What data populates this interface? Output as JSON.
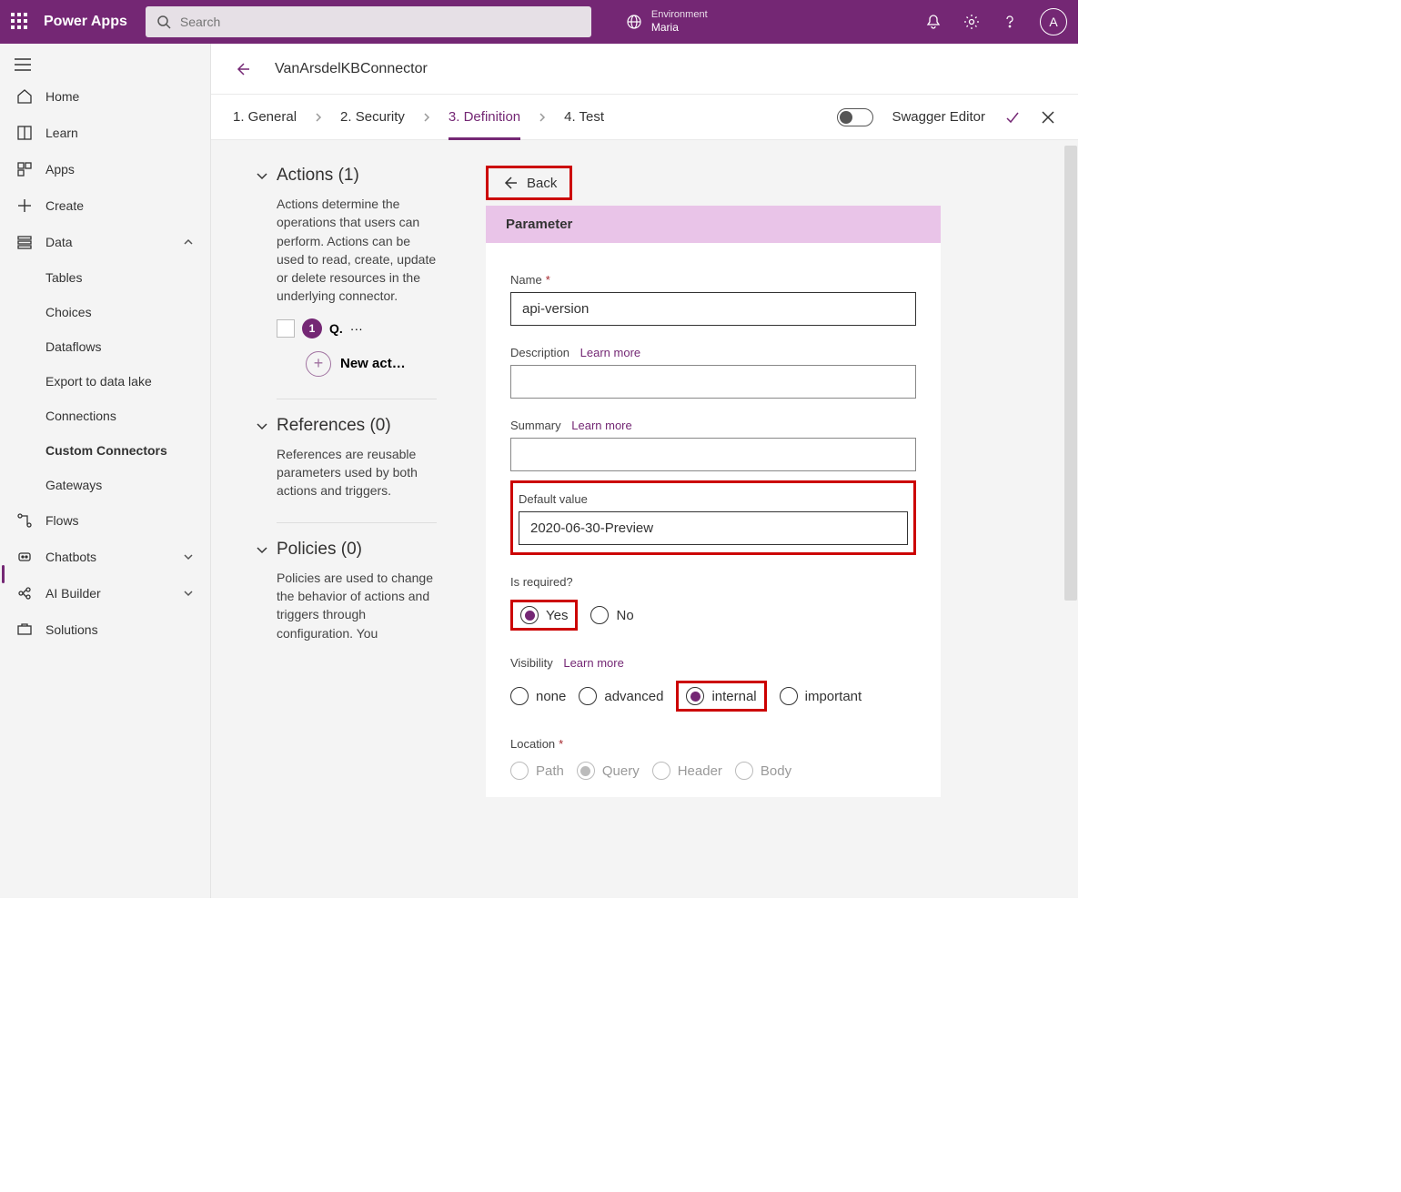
{
  "header": {
    "brand": "Power Apps",
    "search_placeholder": "Search",
    "env_label": "Environment",
    "env_name": "Maria",
    "avatar_initial": "A"
  },
  "sidebar": {
    "items": [
      {
        "label": "Home"
      },
      {
        "label": "Learn"
      },
      {
        "label": "Apps"
      },
      {
        "label": "Create"
      },
      {
        "label": "Data"
      },
      {
        "label": "Tables"
      },
      {
        "label": "Choices"
      },
      {
        "label": "Dataflows"
      },
      {
        "label": "Export to data lake"
      },
      {
        "label": "Connections"
      },
      {
        "label": "Custom Connectors"
      },
      {
        "label": "Gateways"
      },
      {
        "label": "Flows"
      },
      {
        "label": "Chatbots"
      },
      {
        "label": "AI Builder"
      },
      {
        "label": "Solutions"
      }
    ]
  },
  "titlebar": {
    "name": "VanArsdelKBConnector"
  },
  "steps": {
    "s1": "1. General",
    "s2": "2. Security",
    "s3": "3. Definition",
    "s4": "4. Test",
    "swagger": "Swagger Editor"
  },
  "leftcol": {
    "actions_title": "Actions (1)",
    "actions_desc": "Actions determine the operations that users can perform. Actions can be used to read, create, update or delete resources in the underlying connector.",
    "action_badge": "1",
    "action_q": "Q.",
    "action_dots": "···",
    "new_action": "New act…",
    "refs_title": "References (0)",
    "refs_desc": "References are reusable parameters used by both actions and triggers.",
    "policies_title": "Policies (0)",
    "policies_desc": "Policies are used to change the behavior of actions and triggers through configuration. You"
  },
  "form": {
    "back": "Back",
    "panel_title": "Parameter",
    "name_label": "Name",
    "name_value": "api-version",
    "desc_label": "Description",
    "learn_more": "Learn more",
    "summary_label": "Summary",
    "default_label": "Default value",
    "default_value": "2020-06-30-Preview",
    "required_label": "Is required?",
    "yes": "Yes",
    "no": "No",
    "visibility_label": "Visibility",
    "v_none": "none",
    "v_advanced": "advanced",
    "v_internal": "internal",
    "v_important": "important",
    "location_label": "Location",
    "l_path": "Path",
    "l_query": "Query",
    "l_header": "Header",
    "l_body": "Body"
  }
}
